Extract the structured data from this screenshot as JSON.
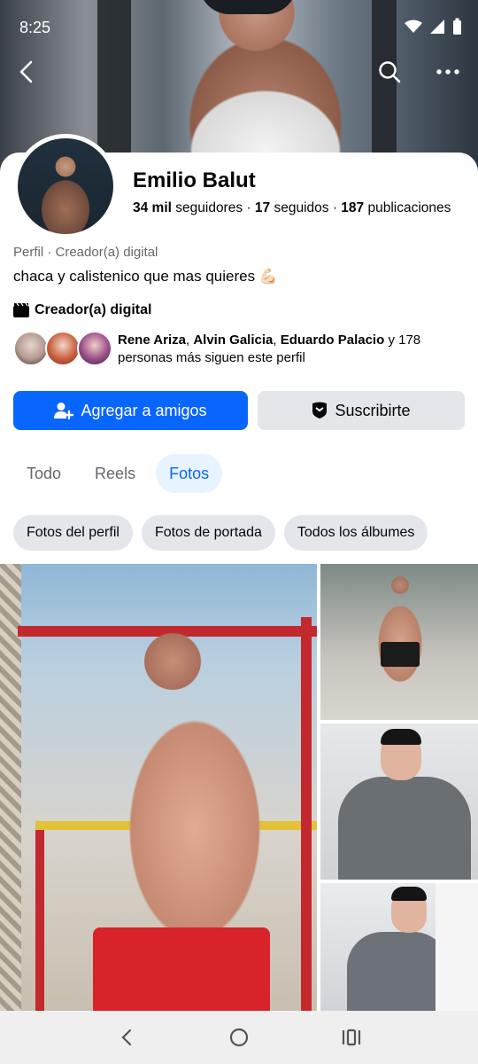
{
  "status": {
    "time": "8:25"
  },
  "profile": {
    "name": "Emilio Balut",
    "followers_count": "34 mil",
    "followers_label": "seguidores",
    "following_count": "17",
    "following_label": "seguidos",
    "posts_count": "187",
    "posts_label": "publicaciones",
    "separator": "·",
    "category_line": "Perfil · Creador(a) digital",
    "bio": "chaca y calistenico que mas quieres 💪🏻",
    "creator_label": "Creador(a) digital"
  },
  "mutuals": {
    "name1": "Rene Ariza",
    "name2": "Alvin Galicia",
    "name3": "Eduardo Palacio",
    "count_text": "y 178",
    "suffix": "personas más siguen este perfil"
  },
  "actions": {
    "add_friend": "Agregar a amigos",
    "subscribe": "Suscribirte"
  },
  "tabs": [
    {
      "label": "Todo",
      "active": false
    },
    {
      "label": "Reels",
      "active": false
    },
    {
      "label": "Fotos",
      "active": true
    }
  ],
  "filters": [
    "Fotos del perfil",
    "Fotos de portada",
    "Todos los álbumes"
  ],
  "colors": {
    "primary": "#0866ff",
    "secondary_bg": "#e4e6eb",
    "active_tab_bg": "#e7f3ff",
    "text": "#050505",
    "muted": "#65676b"
  },
  "icons": {
    "back": "arrow-left-icon",
    "search": "search-icon",
    "more": "more-dots-icon",
    "add_friend": "person-add-icon",
    "subscribe": "shield-badge-icon",
    "creator": "clapperboard-icon"
  }
}
